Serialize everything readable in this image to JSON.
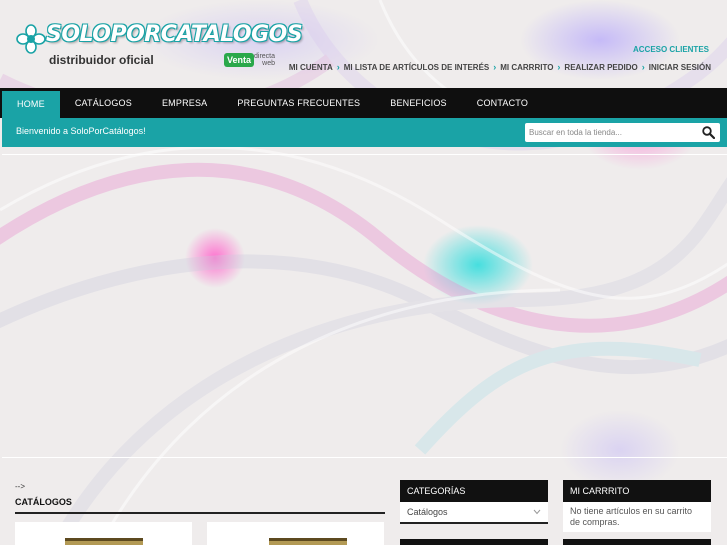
{
  "brand": {
    "logo_text": "SOLOPORCATALOGOS",
    "subtitle": "distribuidor oficial",
    "badge_main": "Venta",
    "badge_side_1": "directa",
    "badge_side_2": "web"
  },
  "header": {
    "acceso_label": "ACCESO CLIENTES",
    "top_links": [
      "MI CUENTA",
      "MI LISTA DE ARTÍCULOS DE INTERÉS",
      "MI CARRRITO",
      "REALIZAR PEDIDO",
      "INICIAR SESIÓN"
    ]
  },
  "nav": {
    "items": [
      "HOME",
      "CATÁLOGOS",
      "EMPRESA",
      "PREGUNTAS FRECUENTES",
      "BENEFICIOS",
      "CONTACTO"
    ],
    "active": "HOME"
  },
  "welcome": {
    "text": "Bienvenido a SoloPorCatálogos!",
    "search_placeholder": "Buscar en toda la tienda..."
  },
  "main": {
    "stray_text": "-->",
    "section_title": "CATÁLOGOS"
  },
  "sidebar": {
    "categories_title": "CATEGORÍAS",
    "categories_selected": "Catálogos",
    "cart_title": "MI CARRRITO",
    "cart_empty": "No tiene artículos en su carrito de compras."
  },
  "colors": {
    "accent": "#1aa3a6",
    "nav_bg": "#0f0f0f",
    "page_bg": "#efecec"
  },
  "icons": {
    "logo": "flower-icon",
    "search": "search-icon",
    "separator": "chevron-right-icon",
    "dropdown": "chevron-down-icon"
  }
}
